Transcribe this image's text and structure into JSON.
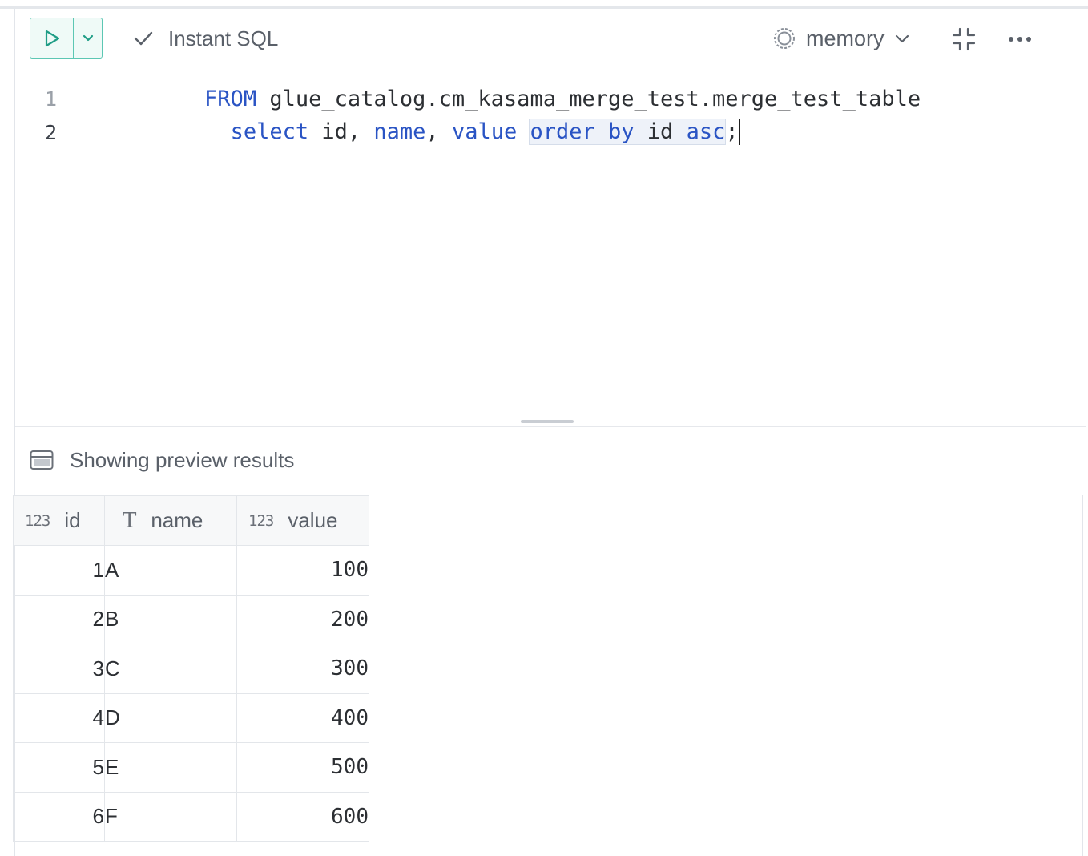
{
  "toolbar": {
    "instant_sql_label": "Instant SQL",
    "database_label": "memory"
  },
  "editor": {
    "lines": [
      {
        "number": "1",
        "kw1": "FROM",
        "text1": " glue_catalog.cm_kasama_merge_test.merge_test_table"
      },
      {
        "number": "2",
        "indent": "  ",
        "kw_select": "select",
        "col_id": " id, ",
        "kw_name": "name",
        "comma": ", ",
        "kw_value": "value",
        "space": " ",
        "kw_order": "order",
        "space2": " ",
        "kw_by": "by",
        "col_id2": " id ",
        "kw_asc": "asc",
        "semicolon": ";"
      }
    ]
  },
  "results": {
    "header_text": "Showing preview results",
    "columns": [
      {
        "type_icon": "123",
        "name": "id"
      },
      {
        "type_icon": "T",
        "name": "name"
      },
      {
        "type_icon": "123",
        "name": "value"
      }
    ],
    "rows": [
      {
        "id": "1",
        "name": "A",
        "value": "100"
      },
      {
        "id": "2",
        "name": "B",
        "value": "200"
      },
      {
        "id": "3",
        "name": "C",
        "value": "300"
      },
      {
        "id": "4",
        "name": "D",
        "value": "400"
      },
      {
        "id": "5",
        "name": "E",
        "value": "500"
      },
      {
        "id": "6",
        "name": "F",
        "value": "600"
      }
    ]
  },
  "colors": {
    "accent": "#5cc7b3",
    "keyword": "#2a54c4"
  }
}
